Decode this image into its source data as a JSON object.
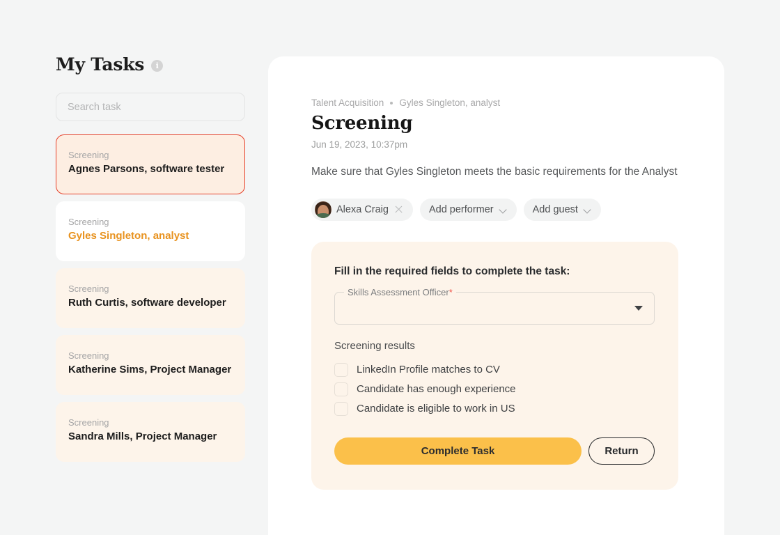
{
  "sidebar": {
    "title": "My Tasks",
    "info_icon": "info-icon",
    "search": {
      "placeholder": "Search task",
      "value": ""
    },
    "tasks": [
      {
        "stage": "Screening",
        "name": "Agnes Parsons, software tester",
        "state": "active"
      },
      {
        "stage": "Screening",
        "name": "Gyles Singleton, analyst",
        "state": "open"
      },
      {
        "stage": "Screening",
        "name": "Ruth Curtis, software developer",
        "state": "default"
      },
      {
        "stage": "Screening",
        "name": "Katherine Sims, Project Manager",
        "state": "default"
      },
      {
        "stage": "Screening",
        "name": "Sandra Mills, Project Manager",
        "state": "default"
      }
    ]
  },
  "detail": {
    "breadcrumb": {
      "project": "Talent Acquisition",
      "candidate": "Gyles Singleton, analyst"
    },
    "title": "Screening",
    "date": "Jun 19, 2023, 10:37pm",
    "description": "Make sure that Gyles Singleton meets the basic requirements for the Analyst",
    "chips": [
      {
        "label": "Alexa Craig",
        "type": "person",
        "trailing": "close-icon"
      },
      {
        "label": "Add performer",
        "type": "add",
        "trailing": "chevron-down-icon"
      },
      {
        "label": "Add guest",
        "type": "add",
        "trailing": "chevron-down-icon"
      }
    ]
  },
  "form": {
    "heading": "Fill in the required fields to complete the task:",
    "select": {
      "label": "Skills Assessment Officer",
      "required_marker": "*",
      "value": ""
    },
    "results_label": "Screening results",
    "checkboxes": [
      {
        "label": "LinkedIn Profile matches to CV",
        "checked": false
      },
      {
        "label": "Candidate has enough experience",
        "checked": false
      },
      {
        "label": "Candidate is eligible to work in US",
        "checked": false
      }
    ],
    "primary_button": "Complete Task",
    "secondary_button": "Return"
  },
  "colors": {
    "page_bg": "#f4f5f5",
    "panel_bg": "#ffffff",
    "card_cream": "#fdf4ea",
    "active_border": "#e5402a",
    "accent_orange": "#e8921e",
    "primary_button": "#fbc04a",
    "required_star": "#f0564a"
  }
}
